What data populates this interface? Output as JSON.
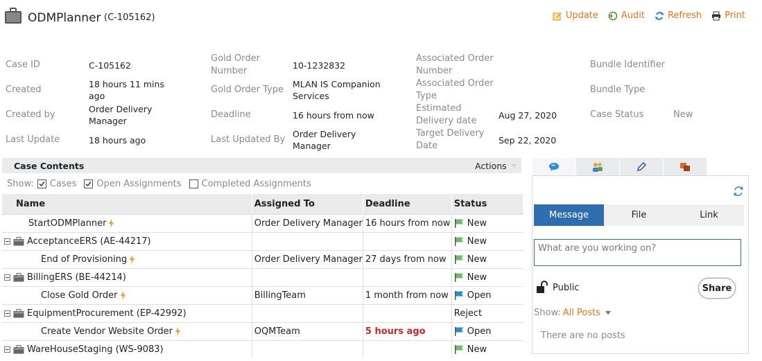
{
  "header": {
    "title": "ODMPlanner",
    "case_ref": "(C-105162)",
    "actions": [
      "Update",
      "Audit",
      "Refresh",
      "Print"
    ]
  },
  "fields": {
    "col1": [
      {
        "label": "Case ID",
        "value": "C-105162"
      },
      {
        "label": "Created",
        "value": "18 hours 11 mins ago"
      },
      {
        "label": "Created by",
        "value": "Order Delivery Manager"
      },
      {
        "label": "Last Update",
        "value": "18 hours ago"
      }
    ],
    "col2": [
      {
        "label": "Gold Order Number",
        "value": "10-1232832"
      },
      {
        "label": "Gold Order Type",
        "value": "MLAN IS Companion Services"
      },
      {
        "label": "Deadline",
        "value": "16 hours from now"
      },
      {
        "label": "Last Updated By",
        "value": "Order Delivery Manager"
      }
    ],
    "col3": [
      {
        "label": "Associated Order Number",
        "value": ""
      },
      {
        "label": "Associated Order Type",
        "value": ""
      },
      {
        "label": "Estimated Delivery date",
        "value": "Aug 27, 2020"
      },
      {
        "label": "Target Delivery Date",
        "value": "Sep 22, 2020"
      }
    ],
    "col4": [
      {
        "label": "Bundle Identifier",
        "value": ""
      },
      {
        "label": "Bundle Type",
        "value": ""
      },
      {
        "label": "Case Status",
        "value": "New"
      }
    ]
  },
  "case_contents": {
    "title": "Case Contents",
    "actions_label": "Actions",
    "show_label": "Show:",
    "filters": [
      {
        "label": "Cases",
        "checked": true
      },
      {
        "label": "Open Assignments",
        "checked": true
      },
      {
        "label": "Completed Assignments",
        "checked": false
      }
    ],
    "columns": [
      "Name",
      "Assigned To",
      "Deadline",
      "Status"
    ],
    "rows": [
      {
        "name": "StartODMPlanner",
        "assigned": "Order Delivery Manager",
        "deadline": "16 hours from now",
        "status": "New"
      },
      {
        "name": "AcceptanceERS (AE-44217)",
        "assigned": "",
        "deadline": "",
        "status": "New"
      },
      {
        "name": "End of Provisioning",
        "assigned": "Order Delivery Manager",
        "deadline": "27 days from now",
        "status": "New"
      },
      {
        "name": "BillingERS (BE-44214)",
        "assigned": "",
        "deadline": "",
        "status": "New"
      },
      {
        "name": "Close Gold Order",
        "assigned": "BillingTeam",
        "deadline": "1 month from now",
        "status": "Open"
      },
      {
        "name": "EquipmentProcurement (EP-42992)",
        "assigned": "",
        "deadline": "",
        "status": "Reject"
      },
      {
        "name": "Create Vendor Website Order",
        "assigned": "OQMTeam",
        "deadline": "5 hours ago",
        "status": "Open"
      },
      {
        "name": "WareHouseStaging (WS-9083)",
        "assigned": "",
        "deadline": "",
        "status": "New"
      }
    ]
  },
  "pulse": {
    "tabs": [
      "chat-icon",
      "people-icon",
      "pencil-icon",
      "cases-icon"
    ],
    "segments": [
      "Message",
      "File",
      "Link"
    ],
    "placeholder": "What are you working on?",
    "visibility": "Public",
    "share_label": "Share",
    "show_label": "Show:",
    "show_value": "All Posts",
    "empty_text": "There are no posts"
  },
  "colors": {
    "accent": "#e8731a",
    "primary": "#2f6eae",
    "flag_green": "#6dbb6a",
    "flag_blue": "#2a8fc8",
    "overdue": "#c62828"
  }
}
